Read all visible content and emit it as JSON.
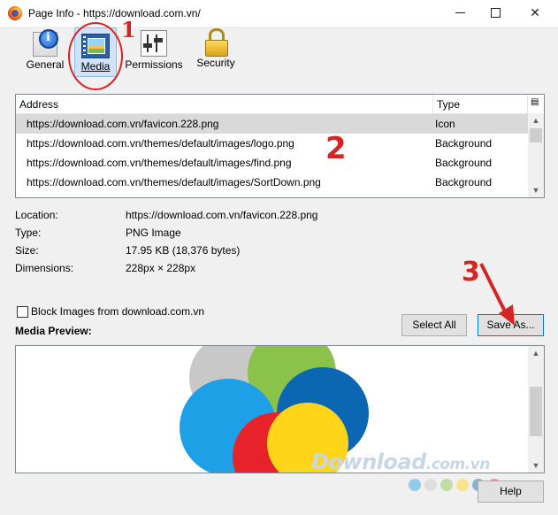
{
  "window": {
    "title": "Page Info - https://download.com.vn/"
  },
  "toolbar": {
    "tabs": [
      {
        "label": "General",
        "icon": "info-icon"
      },
      {
        "label": "Media",
        "icon": "media-icon",
        "selected": true
      },
      {
        "label": "Permissions",
        "icon": "permissions-icon"
      },
      {
        "label": "Security",
        "icon": "lock-icon"
      }
    ]
  },
  "annotations": {
    "one": "1",
    "two": "2",
    "three": "3",
    "color": "#d62424"
  },
  "media_list": {
    "columns": [
      "Address",
      "Type"
    ],
    "rows": [
      {
        "address": "https://download.com.vn/favicon.228.png",
        "type": "Icon",
        "selected": true
      },
      {
        "address": "https://download.com.vn/themes/default/images/logo.png",
        "type": "Background"
      },
      {
        "address": "https://download.com.vn/themes/default/images/find.png",
        "type": "Background"
      },
      {
        "address": "https://download.com.vn/themes/default/images/SortDown.png",
        "type": "Background"
      }
    ]
  },
  "details": {
    "location_label": "Location:",
    "location": "https://download.com.vn/favicon.228.png",
    "type_label": "Type:",
    "type": "PNG Image",
    "size_label": "Size:",
    "size": "17.95 KB (18,376 bytes)",
    "dimensions_label": "Dimensions:",
    "dimensions": "228px × 228px"
  },
  "block_images": {
    "label": "Block Images from download.com.vn",
    "checked": false
  },
  "buttons": {
    "select_all": "Select All",
    "save_as": "Save As...",
    "help": "Help"
  },
  "preview": {
    "label": "Media Preview:"
  },
  "watermark": {
    "text": "Download",
    "suffix": ".com.vn"
  }
}
